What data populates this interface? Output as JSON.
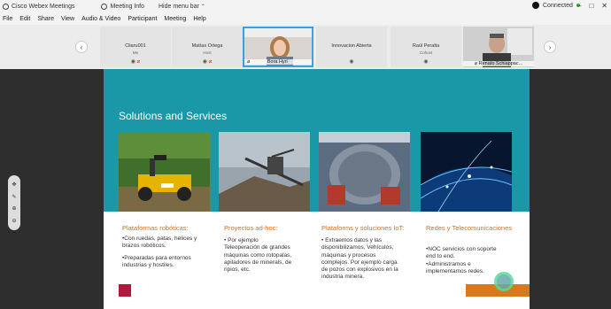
{
  "titlebar": {
    "app_name": "Cisco Webex Meetings",
    "meeting_info": "Meeting Info",
    "hide_menu": "Hide menu bar",
    "connection": "Connected"
  },
  "menu": [
    "File",
    "Edit",
    "Share",
    "View",
    "Audio & Video",
    "Participant",
    "Meeting",
    "Help"
  ],
  "participants": [
    {
      "name": "Cliaru001",
      "sub": "Me"
    },
    {
      "name": "Matías Ortega",
      "sub": "Host"
    },
    {
      "name": "Bora Hyri"
    },
    {
      "name": "Innovacion Abierta",
      "sub": ""
    },
    {
      "name": "Raúl Peralta",
      "sub": "Cohost"
    },
    {
      "name": "Renato Schiappac..."
    }
  ],
  "slide": {
    "title": "Solutions and Services",
    "cards": [
      {
        "title": "Plataformas robóticas:",
        "body": [
          "•Con ruedas, patas, helices y",
          "  brazos robóticos.",
          "",
          "•Preparadas para entornos",
          "  industrias y hostiles."
        ]
      },
      {
        "title": "Proyectos ad-hoc:",
        "body": [
          "• Por ejemplo",
          "Teleoperación de grandes",
          "máquinas como rotopalas,",
          "apiladores de minerals, de",
          "ripios, etc."
        ]
      },
      {
        "title": "Plataforms y soluciones IoT:",
        "body": [
          "• Extraemos datos y las",
          "disponibilizamos, Vehículos,",
          "máquinas y procesos",
          "complejos. Por ejemplo carga",
          "de pozos con explosivos en la",
          "industria minera."
        ]
      },
      {
        "title": "Redes y Telecomunicaciones",
        "body": [
          "•NOC servicios con soporte",
          "end to end.",
          "•Administramos e",
          "implementamos redes."
        ]
      }
    ]
  },
  "colors": {
    "teal": "#1a98a8",
    "orange": "#d36e1e",
    "crimson": "#b0193b"
  }
}
